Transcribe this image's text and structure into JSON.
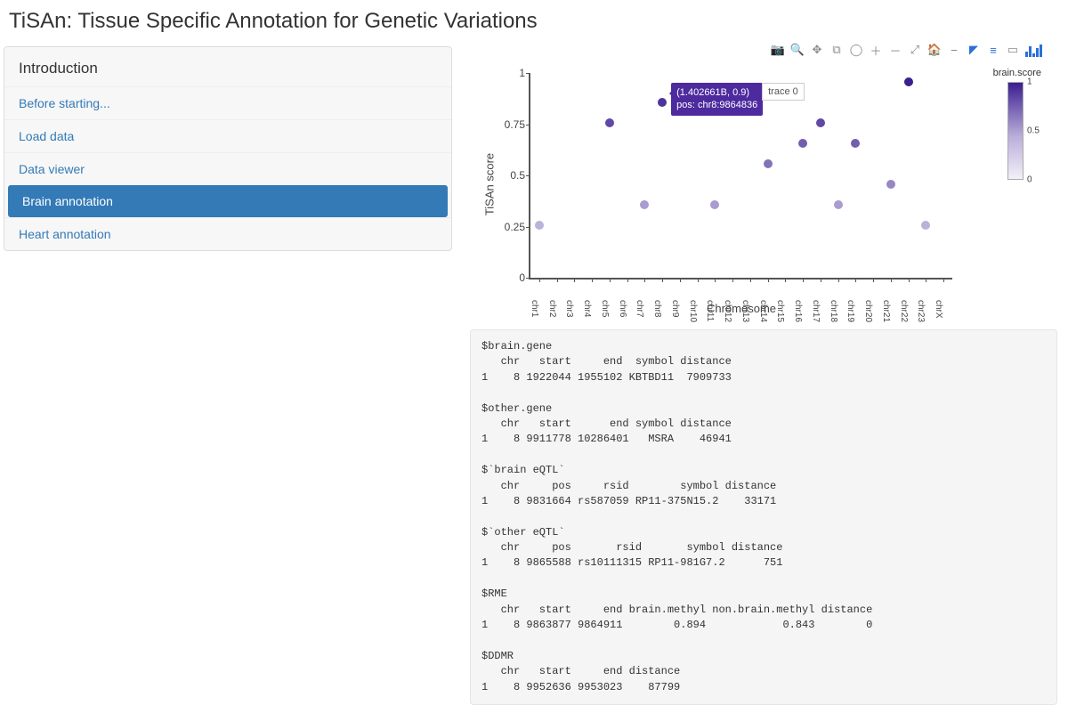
{
  "page_title": "TiSAn: Tissue Specific Annotation for Genetic Variations",
  "sidebar": {
    "title": "Introduction",
    "items": [
      {
        "label": "Before starting...",
        "active": false
      },
      {
        "label": "Load data",
        "active": false
      },
      {
        "label": "Data viewer",
        "active": false
      },
      {
        "label": "Brain annotation",
        "active": true
      },
      {
        "label": "Heart annotation",
        "active": false
      }
    ]
  },
  "modebar": {
    "tools": [
      "camera",
      "zoom",
      "pan",
      "select-box",
      "lasso",
      "zoom-in",
      "zoom-out",
      "autoscale",
      "reset",
      "toggle-spike",
      "show-closest",
      "compare",
      "toggle-hover"
    ]
  },
  "chart_data": {
    "type": "scatter",
    "title": "",
    "xlabel": "Chromosome",
    "ylabel": "TiSAn score",
    "ylim": [
      0,
      1
    ],
    "yticks": [
      0,
      0.25,
      0.5,
      0.75,
      1
    ],
    "x_categories": [
      "chr1",
      "chr2",
      "chr3",
      "chr4",
      "chr5",
      "chr6",
      "chr7",
      "chr8",
      "chr9",
      "chr10",
      "chr11",
      "chr12",
      "chr13",
      "chr14",
      "chr15",
      "chr16",
      "chr17",
      "chr18",
      "chr19",
      "chr20",
      "chr21",
      "chr22",
      "chr23",
      "chrX"
    ],
    "series": [
      {
        "name": "trace 0",
        "color_by": "brain.score",
        "points": [
          {
            "x": "chr1",
            "y": 0.3,
            "c": 0.3
          },
          {
            "x": "chr5",
            "y": 0.8,
            "c": 0.8
          },
          {
            "x": "chr7",
            "y": 0.4,
            "c": 0.4
          },
          {
            "x": "chr8",
            "y": 0.9,
            "c": 0.9,
            "hover": {
              "line1": "(1.402661B, 0.9)",
              "line2": "pos: chr8:9864836"
            }
          },
          {
            "x": "chr11",
            "y": 0.4,
            "c": 0.4
          },
          {
            "x": "chr14",
            "y": 0.6,
            "c": 0.6
          },
          {
            "x": "chr16",
            "y": 0.7,
            "c": 0.7
          },
          {
            "x": "chr17",
            "y": 0.8,
            "c": 0.8
          },
          {
            "x": "chr18",
            "y": 0.4,
            "c": 0.4
          },
          {
            "x": "chr19",
            "y": 0.7,
            "c": 0.7
          },
          {
            "x": "chr21",
            "y": 0.5,
            "c": 0.5
          },
          {
            "x": "chr22",
            "y": 1.0,
            "c": 1.0
          },
          {
            "x": "chr23",
            "y": 0.3,
            "c": 0.3
          }
        ]
      }
    ],
    "colorbar": {
      "title": "brain.score",
      "min": 0,
      "mid": 0.5,
      "max": 1
    },
    "hover_trace_label": "trace 0"
  },
  "console_output": "$brain.gene\n   chr   start     end  symbol distance\n1    8 1922044 1955102 KBTBD11  7909733\n\n$other.gene\n   chr   start      end symbol distance\n1    8 9911778 10286401   MSRA    46941\n\n$`brain eQTL`\n   chr     pos     rsid        symbol distance\n1    8 9831664 rs587059 RP11-375N15.2    33171\n\n$`other eQTL`\n   chr     pos       rsid       symbol distance\n1    8 9865588 rs10111315 RP11-981G7.2      751\n\n$RME\n   chr   start     end brain.methyl non.brain.methyl distance\n1    8 9863877 9864911        0.894            0.843        0\n\n$DDMR\n   chr   start     end distance\n1    8 9952636 9953023    87799"
}
